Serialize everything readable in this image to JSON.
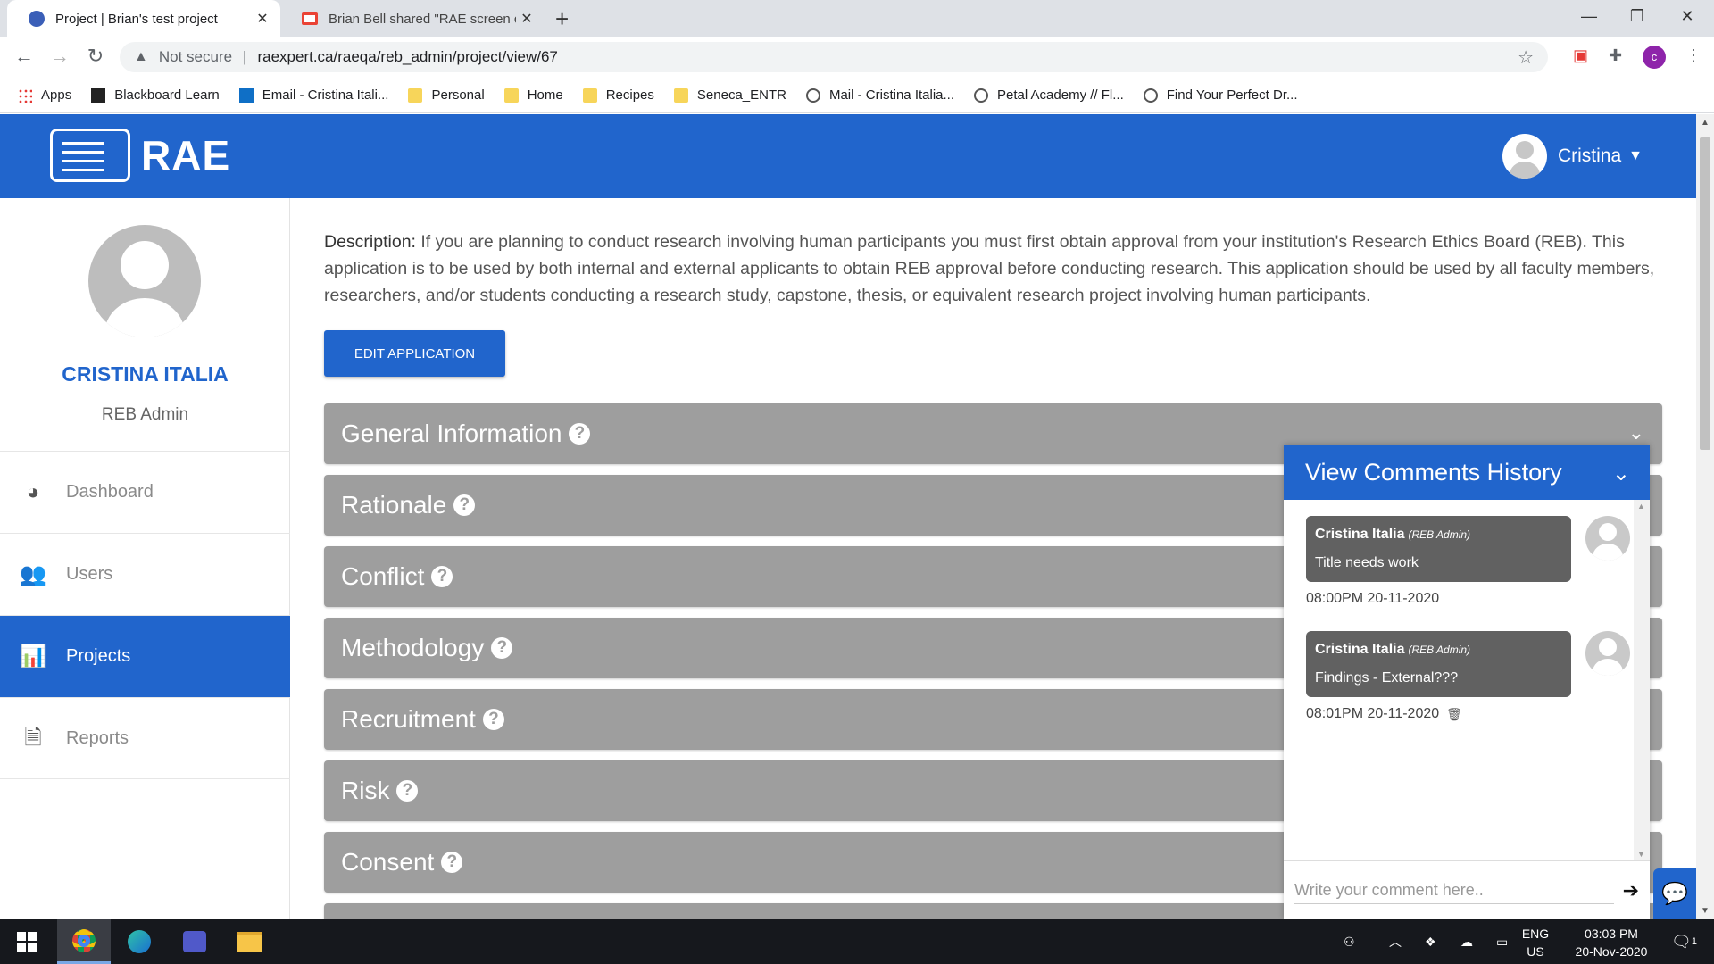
{
  "browser": {
    "tabs": [
      {
        "title": "Project | Brian's test project",
        "close": "✕"
      },
      {
        "title": "Brian Bell shared \"RAE screen cap",
        "close": "✕"
      }
    ],
    "new_tab": "+",
    "window_controls": {
      "minimize": "—",
      "maximize": "❐",
      "close": "✕"
    },
    "nav": {
      "back": "←",
      "forward": "→",
      "reload": "↻"
    },
    "address": {
      "security_icon": "warning-triangle-icon",
      "security_text": "Not secure",
      "separator": "|",
      "url": "raexpert.ca/raeqa/reb_admin/project/view/67"
    },
    "star": "☆",
    "profile_initial": "c",
    "bookmarks": [
      {
        "label": "Apps",
        "icon": "apps"
      },
      {
        "label": "Blackboard Learn",
        "icon": "bb"
      },
      {
        "label": "Email - Cristina Itali...",
        "icon": "ol"
      },
      {
        "label": "Personal",
        "icon": "folder"
      },
      {
        "label": "Home",
        "icon": "folder"
      },
      {
        "label": "Recipes",
        "icon": "folder"
      },
      {
        "label": "Seneca_ENTR",
        "icon": "folder"
      },
      {
        "label": "Mail - Cristina Italia...",
        "icon": "globe"
      },
      {
        "label": "Petal Academy // Fl...",
        "icon": "globe"
      },
      {
        "label": "Find Your Perfect Dr...",
        "icon": "globe"
      }
    ]
  },
  "header": {
    "logo_text": "RAE",
    "user_name": "Cristina",
    "caret": "▼"
  },
  "sidebar": {
    "name": "CRISTINA ITALIA",
    "role": "REB Admin",
    "items": [
      {
        "label": "Dashboard",
        "icon": "◕"
      },
      {
        "label": "Users",
        "icon": "👥"
      },
      {
        "label": "Projects",
        "icon": "📊"
      },
      {
        "label": "Reports",
        "icon": "🗎"
      }
    ]
  },
  "main": {
    "desc_label": "Description:",
    "desc_text": " If you are planning to conduct research involving human participants you must first obtain approval from your institution's Research Ethics Board (REB). This application is to be used by both internal and external applicants to obtain REB approval before conducting research. This application should be used by all faculty members, researchers, and/or students conducting a research study, capstone, thesis, or equivalent research project involving human participants.",
    "edit_button": "EDIT APPLICATION",
    "sections": [
      {
        "title": "General Information"
      },
      {
        "title": "Rationale"
      },
      {
        "title": "Conflict"
      },
      {
        "title": "Methodology"
      },
      {
        "title": "Recruitment"
      },
      {
        "title": "Risk"
      },
      {
        "title": "Consent"
      }
    ],
    "help_glyph": "?",
    "chevron": "⌄"
  },
  "comments": {
    "title": "View Comments History",
    "chevron": "⌄",
    "items": [
      {
        "author": "Cristina Italia",
        "role": "(REB Admin)",
        "text": "Title needs work",
        "time": "08:00PM 20-11-2020"
      },
      {
        "author": "Cristina Italia",
        "role": "(REB Admin)",
        "text": "Findings - External???",
        "time": "08:01PM 20-11-2020"
      }
    ],
    "placeholder": "Write your comment here..",
    "send": "➔",
    "fab": "💬"
  },
  "taskbar": {
    "lang_top": "ENG",
    "lang_bottom": "US",
    "time": "03:03 PM",
    "date": "20-Nov-2020",
    "notifications": "1"
  }
}
